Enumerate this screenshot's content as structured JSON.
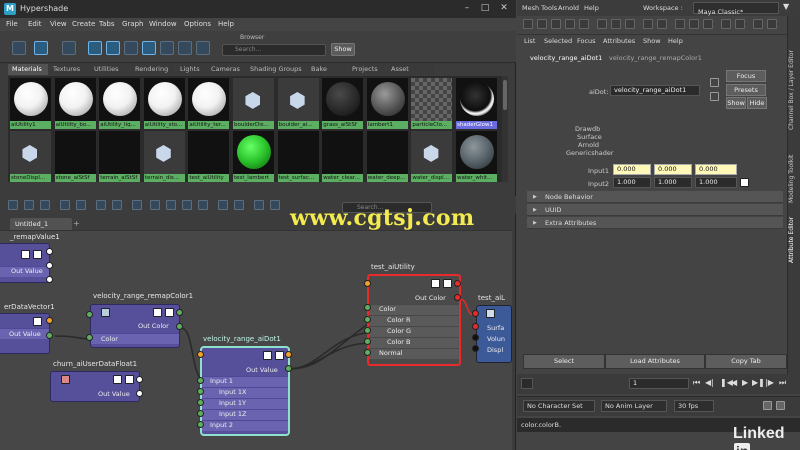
{
  "hypershade": {
    "title": "Hypershade",
    "menu": [
      "File",
      "Edit",
      "View",
      "Create",
      "Tabs",
      "Graph",
      "Window",
      "Options",
      "Help"
    ],
    "browser_label": "Browser",
    "search_placeholder": "Search...",
    "show_label": "Show",
    "tabs": [
      "Materials",
      "Textures",
      "Utilities",
      "Rendering",
      "Lights",
      "Cameras",
      "Shading Groups",
      "Bake Sets",
      "Projects",
      "Asset Nodes"
    ],
    "swatches": [
      {
        "label": "aiUtility1",
        "style": "white"
      },
      {
        "label": "aiUtility_bo...",
        "style": "white"
      },
      {
        "label": "aiUtility_liq...",
        "style": "white"
      },
      {
        "label": "aiUtility_sto...",
        "style": "white"
      },
      {
        "label": "aiUtility_ter...",
        "style": "white"
      },
      {
        "label": "boulderDis...",
        "style": "cube"
      },
      {
        "label": "boulder_ai...",
        "style": "cube"
      },
      {
        "label": "grass_aiStSf",
        "style": "dark"
      },
      {
        "label": "lambert1",
        "style": "grey"
      },
      {
        "label": "particleClo...",
        "style": "checker"
      },
      {
        "label": "shaderGlow1",
        "style": "glow",
        "selected": true
      },
      {
        "label": "stoneDispl...",
        "style": "cube"
      },
      {
        "label": "stone_aiStSf",
        "style": "black"
      },
      {
        "label": "terrain_aiStSf",
        "style": "black"
      },
      {
        "label": "terrain_dis...",
        "style": "cube"
      },
      {
        "label": "test_aiUtility",
        "style": "black"
      },
      {
        "label": "test_lambert",
        "style": "green"
      },
      {
        "label": "test_surfac...",
        "style": "black"
      },
      {
        "label": "water_clear...",
        "style": "black"
      },
      {
        "label": "water_deep...",
        "style": "black"
      },
      {
        "label": "water_displ...",
        "style": "cube"
      },
      {
        "label": "water_whit...",
        "style": "stone"
      }
    ],
    "graph_search_placeholder": "Search...",
    "editor_tab": "Untitled_1",
    "add_tab": "+",
    "nodes": {
      "remap_value": {
        "title": "_remapValue1",
        "out": "Out Value"
      },
      "user_data_vector": {
        "title": "erDataVector1",
        "out": "Out Value"
      },
      "remap_color": {
        "title": "velocity_range_remapColor1",
        "out": "Out Color",
        "in": "Color"
      },
      "churn": {
        "title": "churn_aiUserDataFloat1",
        "out": "Out Value"
      },
      "dot": {
        "title": "velocity_range_aiDot1",
        "out": "Out Value",
        "inputs": [
          "Input 1",
          "Input 1X",
          "Input 1Y",
          "Input 1Z",
          "Input 2"
        ]
      },
      "test_utility": {
        "title": "test_aiUtility",
        "out": "Out Color",
        "inputs": [
          "Color",
          "Color R",
          "Color G",
          "Color B",
          "Normal"
        ]
      },
      "test_ai": {
        "title": "test_aiL",
        "inputs": [
          "Surfa",
          "Volun",
          "Displ"
        ]
      }
    }
  },
  "watermark": "www.cgtsj.com",
  "main": {
    "menu": [
      "Mesh Tools",
      "Arnold",
      "Help"
    ],
    "workspace_label": "Workspace :",
    "workspace_value": "Maya Classic*"
  },
  "attribute_editor": {
    "menu": [
      "List",
      "Selected",
      "Focus",
      "Attributes",
      "Show",
      "Help"
    ],
    "tabs": [
      "velocity_range_aiDot1",
      "velocity_range_remapColor1"
    ],
    "node_label": "aiDot:",
    "node_value": "velocity_range_aiDot1",
    "focus": "Focus",
    "presets": "Presets",
    "show": "Show",
    "hide": "Hide",
    "classification": [
      "Drawdb",
      "Surface",
      "Arnold",
      "Genericshader"
    ],
    "input1_label": "Input1",
    "input1": [
      "0.000",
      "0.000",
      "0.000"
    ],
    "input2_label": "Input2",
    "input2": [
      "1.000",
      "1.000",
      "1.000"
    ],
    "sections": [
      "Node Behavior",
      "UUID",
      "Extra Attributes"
    ],
    "select": "Select",
    "load_attributes": "Load Attributes",
    "copy_tab": "Copy Tab",
    "side_tabs": [
      "Channel Box / Layer Editor",
      "Modeling Toolkit",
      "Attribute Editor"
    ]
  },
  "timeline": {
    "frame": "1",
    "no_character_set": "No Character Set",
    "no_anim_layer": "No Anim Layer",
    "fps": "30 fps"
  },
  "command_line": "color.colorB.",
  "branding": {
    "linked": "Linked",
    "in": "in"
  }
}
